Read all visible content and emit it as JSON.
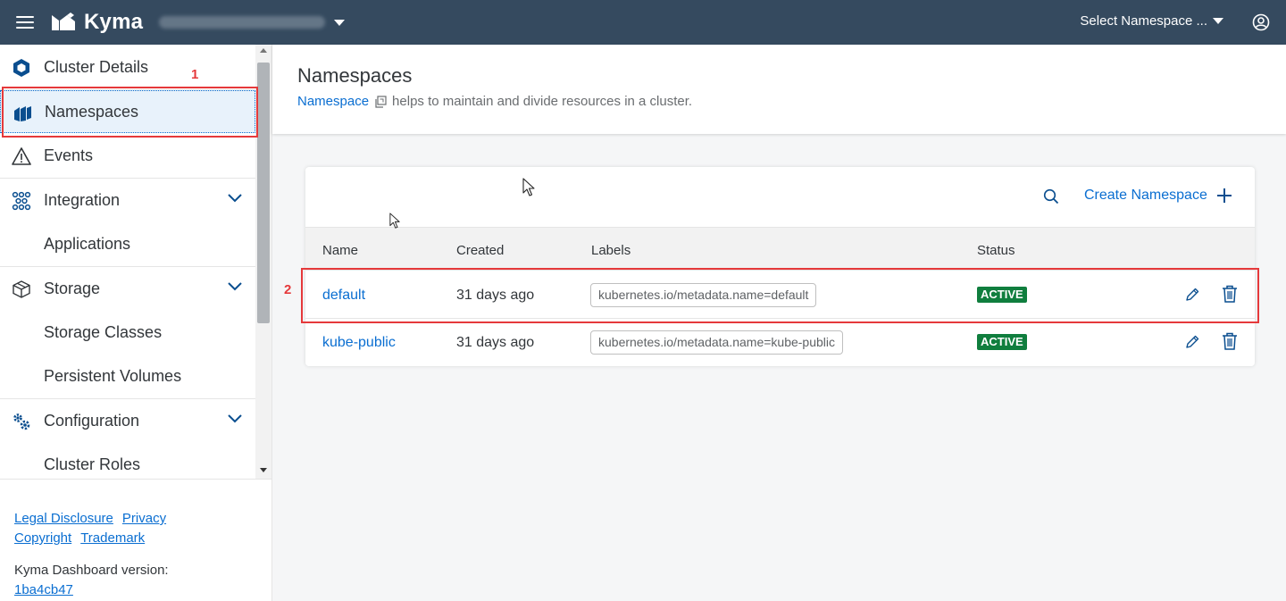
{
  "header": {
    "app_name": "Kyma",
    "namespace_select": "Select Namespace ..."
  },
  "sidebar": {
    "items": [
      {
        "label": "Cluster Details",
        "icon": "cluster-icon"
      },
      {
        "label": "Namespaces",
        "icon": "namespaces-icon",
        "selected": true
      },
      {
        "label": "Events",
        "icon": "warning-icon"
      },
      {
        "label": "Integration",
        "icon": "integration-icon",
        "expanded": true
      },
      {
        "label": "Applications"
      },
      {
        "label": "Storage",
        "icon": "storage-icon",
        "expanded": true
      },
      {
        "label": "Storage Classes"
      },
      {
        "label": "Persistent Volumes"
      },
      {
        "label": "Configuration",
        "icon": "gears-icon",
        "expanded": true
      },
      {
        "label": "Cluster Roles"
      }
    ],
    "footer": {
      "links": [
        "Legal Disclosure",
        "Privacy",
        "Copyright",
        "Trademark"
      ],
      "version_label": "Kyma Dashboard version:",
      "version": "1ba4cb47"
    }
  },
  "page": {
    "title": "Namespaces",
    "description_link": "Namespace",
    "description_text": "helps to maintain and divide resources in a cluster."
  },
  "table": {
    "create_label": "Create Namespace",
    "columns": [
      "Name",
      "Created",
      "Labels",
      "Status"
    ],
    "rows": [
      {
        "name": "default",
        "created": "31 days ago",
        "label": "kubernetes.io/metadata.name=default",
        "status": "ACTIVE"
      },
      {
        "name": "kube-public",
        "created": "31 days ago",
        "label": "kubernetes.io/metadata.name=kube-public",
        "status": "ACTIVE"
      }
    ]
  },
  "annotations": [
    "1",
    "2"
  ],
  "colors": {
    "shellbar": "#354a5f",
    "link": "#0a6ed1",
    "status_active": "#107e3e",
    "annotation": "#e5393b"
  }
}
